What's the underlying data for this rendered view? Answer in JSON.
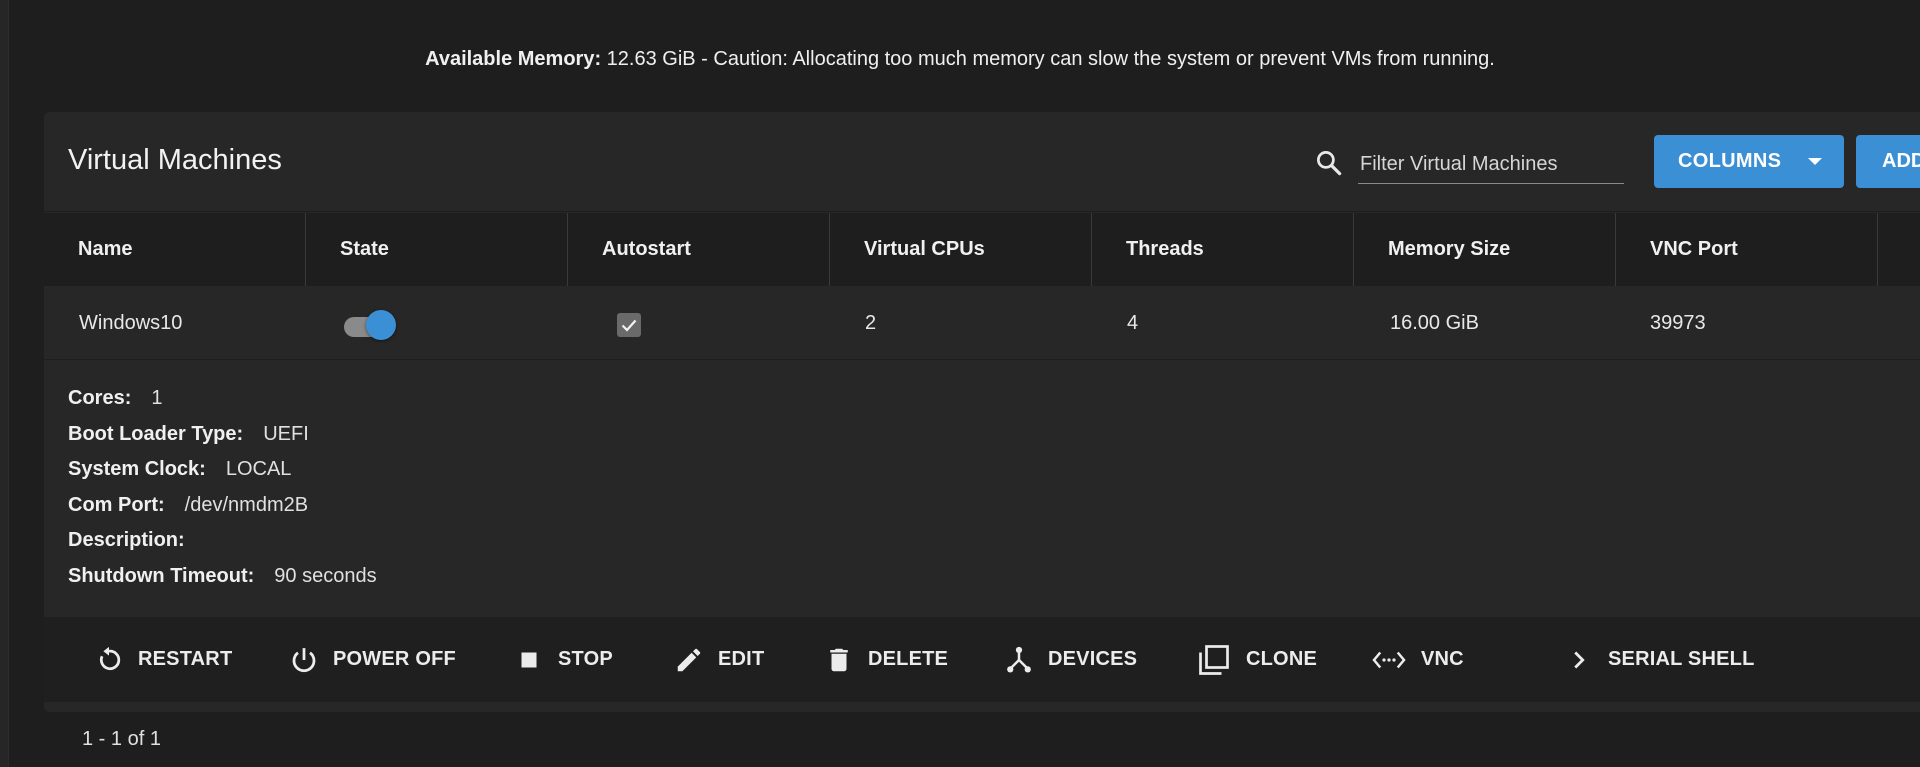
{
  "banner": {
    "label": "Available Memory:",
    "text": " 12.63 GiB - Caution: Allocating too much memory can slow the system or prevent VMs from running."
  },
  "card": {
    "title": "Virtual Machines",
    "search_placeholder": "Filter Virtual Machines",
    "columns_label": "COLUMNS",
    "add_label": "ADD"
  },
  "table": {
    "headers": [
      "Name",
      "State",
      "Autostart",
      "Virtual CPUs",
      "Threads",
      "Memory Size",
      "VNC Port"
    ],
    "rows": [
      {
        "name": "Windows10",
        "state_on": true,
        "autostart": true,
        "vcpus": "2",
        "threads": "4",
        "memory": "16.00 GiB",
        "vnc_port": "39973"
      }
    ]
  },
  "details": {
    "cores_label": "Cores:",
    "cores": "1",
    "bootloader_label": "Boot Loader Type:",
    "bootloader": "UEFI",
    "clock_label": "System Clock:",
    "clock": "LOCAL",
    "comport_label": "Com Port:",
    "comport": "/dev/nmdm2B",
    "description_label": "Description:",
    "description": "",
    "timeout_label": "Shutdown Timeout:",
    "timeout": "90 seconds"
  },
  "actions": {
    "restart": "RESTART",
    "power_off": "POWER OFF",
    "stop": "STOP",
    "edit": "EDIT",
    "delete": "DELETE",
    "devices": "DEVICES",
    "clone": "CLONE",
    "vnc": "VNC",
    "serial_shell": "SERIAL SHELL"
  },
  "pager": {
    "text": "1 - 1 of 1"
  },
  "colors": {
    "accent": "#3b8fd4",
    "background": "#1e1e1e",
    "card": "#272727"
  },
  "icons": [
    "search-icon",
    "restart-icon",
    "power-icon",
    "stop-icon",
    "edit-icon",
    "delete-icon",
    "devices-icon",
    "clone-icon",
    "vnc-icon",
    "chevron-right-icon",
    "check-icon"
  ]
}
